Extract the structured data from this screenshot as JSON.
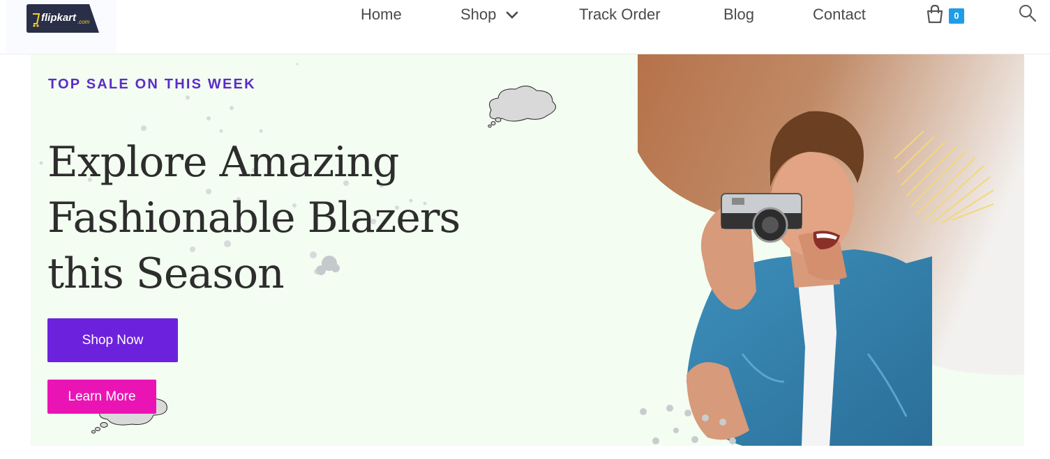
{
  "header": {
    "logo_text": "flipkart",
    "logo_suffix": ".com",
    "nav": [
      {
        "label": "Home"
      },
      {
        "label": "Shop"
      },
      {
        "label": "Track Order"
      },
      {
        "label": "Blog"
      },
      {
        "label": "Contact"
      }
    ],
    "cart_count": "0"
  },
  "hero": {
    "kicker": "TOP SALE ON THIS WEEK",
    "headline_lines": [
      "Explore Amazing",
      "Fashionable Blazers",
      "this Season"
    ],
    "shop_button": "Shop Now",
    "learn_button": "Learn More"
  },
  "colors": {
    "accent_purple": "#6c22dc",
    "accent_pink": "#ea14b5",
    "kicker_purple": "#5b2cc8",
    "badge_blue": "#1e9ce8",
    "hero_bg": "#f3fdf1"
  },
  "icons": [
    "shop-chevron-down-icon",
    "cart-bag-icon",
    "search-icon"
  ]
}
